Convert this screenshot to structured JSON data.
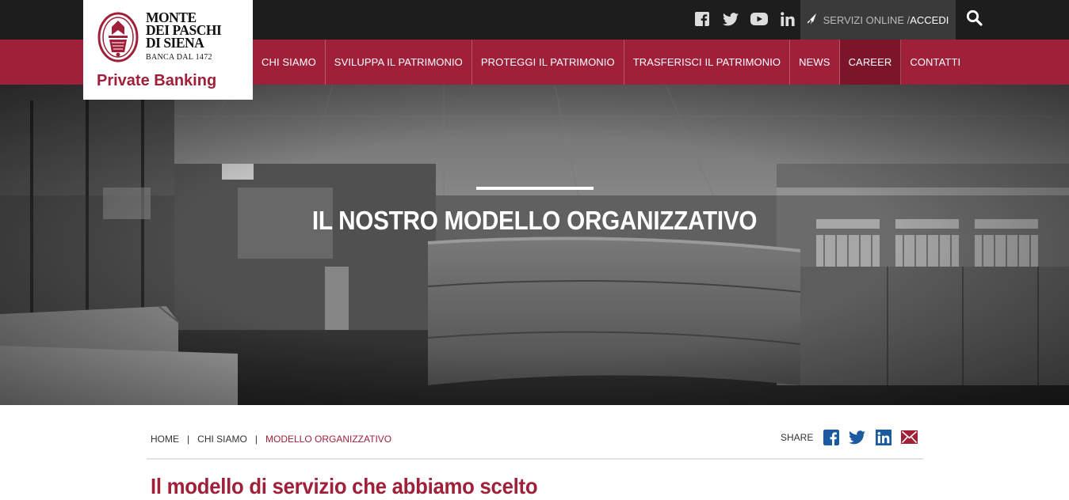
{
  "brand": {
    "name_line1": "MONTE",
    "name_line2": "DEI PASCHI",
    "name_line3": "DI SIENA",
    "since": "BANCA DAL 1472",
    "division": "Private Banking",
    "color": "#a0203a"
  },
  "topbar": {
    "social_icons": [
      "facebook-icon",
      "twitter-icon",
      "youtube-icon",
      "linkedin-icon"
    ],
    "servizi_label": "SERVIZI ONLINE / ",
    "accedi_label": "ACCEDI"
  },
  "nav": {
    "items": [
      {
        "label": "CHI SIAMO"
      },
      {
        "label": "SVILUPPA IL PATRIMONIO"
      },
      {
        "label": "PROTEGGI IL PATRIMONIO"
      },
      {
        "label": "TRASFERISCI IL PATRIMONIO"
      },
      {
        "label": "NEWS"
      },
      {
        "label": "CAREER"
      },
      {
        "label": "CONTATTI"
      }
    ]
  },
  "hero": {
    "title": "IL NOSTRO MODELLO ORGANIZZATIVO"
  },
  "breadcrumb": {
    "items": [
      "HOME",
      "CHI SIAMO",
      "MODELLO ORGANIZZATIVO"
    ],
    "separator": "|"
  },
  "share": {
    "label": "SHARE",
    "icons": [
      "facebook-icon",
      "twitter-icon",
      "linkedin-icon",
      "email-icon"
    ],
    "icon_color": "#1a5aa0"
  },
  "content": {
    "heading": "Il modello di servizio che abbiamo scelto"
  }
}
